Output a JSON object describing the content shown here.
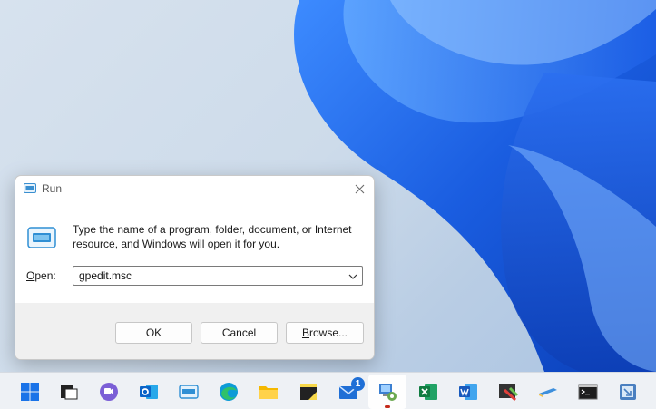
{
  "run_dialog": {
    "title": "Run",
    "message": "Type the name of a program, folder, document, or Internet resource, and Windows will open it for you.",
    "open_label_prefix": "O",
    "open_label_rest": "pen:",
    "input_value": "gpedit.msc",
    "ok_label": "OK",
    "cancel_label": "Cancel",
    "browse_label_prefix": "B",
    "browse_label_rest": "rowse..."
  },
  "taskbar": {
    "items": [
      {
        "name": "start",
        "icon": "windows-logo-icon"
      },
      {
        "name": "task-view",
        "icon": "task-view-icon"
      },
      {
        "name": "teams",
        "icon": "teams-chat-icon"
      },
      {
        "name": "outlook",
        "icon": "outlook-icon"
      },
      {
        "name": "run",
        "icon": "run-icon"
      },
      {
        "name": "edge",
        "icon": "edge-icon"
      },
      {
        "name": "file-explorer",
        "icon": "folder-icon"
      },
      {
        "name": "sticky-notes",
        "icon": "sticky-notes-icon"
      },
      {
        "name": "mail",
        "icon": "mail-icon"
      },
      {
        "name": "group-policy-editor",
        "icon": "group-policy-icon"
      },
      {
        "name": "excel",
        "icon": "excel-icon"
      },
      {
        "name": "word",
        "icon": "word-icon"
      },
      {
        "name": "snipping-tool",
        "icon": "snipping-tool-icon"
      },
      {
        "name": "notepad",
        "icon": "notepad-icon"
      },
      {
        "name": "command-prompt",
        "icon": "cmd-icon"
      },
      {
        "name": "app",
        "icon": "app-icon"
      }
    ],
    "mail_badge": "1"
  },
  "colors": {
    "accent": "#0067c0",
    "wallpaper_blue": "#1565e8",
    "active_indicator": "#c42b1c"
  }
}
